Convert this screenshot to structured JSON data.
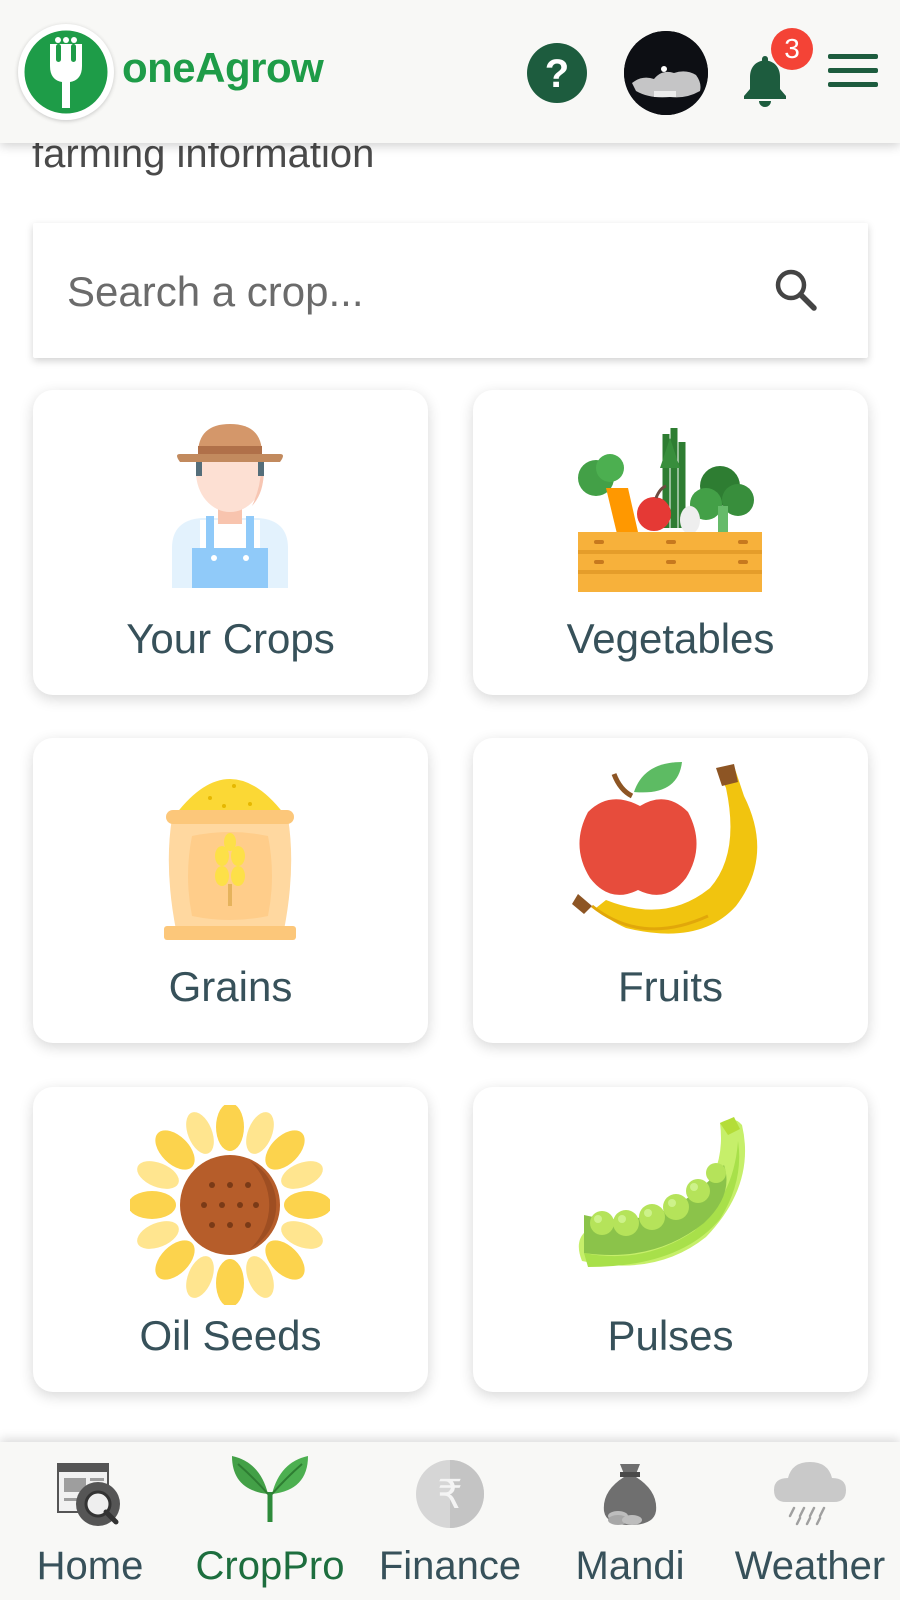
{
  "header": {
    "app_name": "oneAgrow",
    "help_label": "?",
    "notification_count": "3"
  },
  "intro_text": "farming information",
  "search": {
    "placeholder": "Search a crop..."
  },
  "categories": [
    {
      "label": "Your Crops",
      "icon": "farmer-icon"
    },
    {
      "label": "Vegetables",
      "icon": "vegetable-crate-icon"
    },
    {
      "label": "Grains",
      "icon": "grain-sack-icon"
    },
    {
      "label": "Fruits",
      "icon": "apple-banana-icon"
    },
    {
      "label": "Oil Seeds",
      "icon": "sunflower-icon"
    },
    {
      "label": "Pulses",
      "icon": "pea-pod-icon"
    }
  ],
  "bottom_nav": {
    "active": "CropPro",
    "items": [
      {
        "label": "Home",
        "icon": "news-search-icon"
      },
      {
        "label": "CropPro",
        "icon": "sprout-icon"
      },
      {
        "label": "Finance",
        "icon": "rupee-coin-icon"
      },
      {
        "label": "Mandi",
        "icon": "money-bag-icon"
      },
      {
        "label": "Weather",
        "icon": "rain-cloud-icon"
      }
    ]
  },
  "colors": {
    "brand_green": "#1e9c48",
    "dark_green": "#1d5c3e",
    "badge_red": "#f44336",
    "label_text": "#37515a"
  }
}
